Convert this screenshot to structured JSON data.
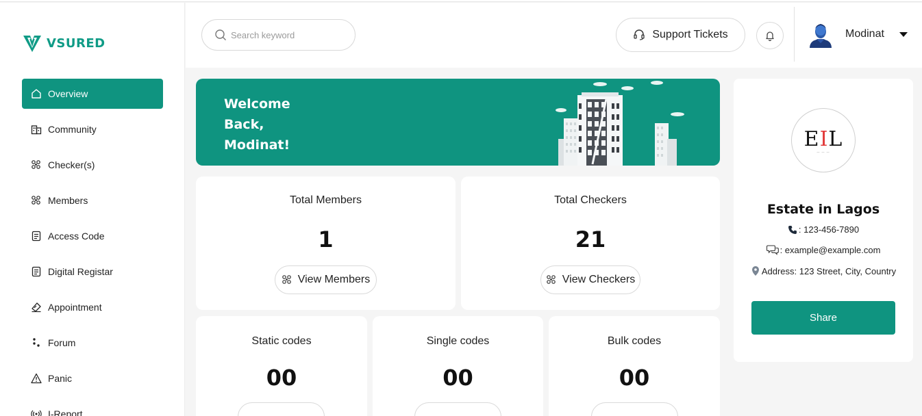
{
  "app": {
    "brand": "VSURED"
  },
  "sidebar": {
    "items": [
      {
        "label": "Overview",
        "icon": "home-icon",
        "active": true
      },
      {
        "label": "Community",
        "icon": "building-icon"
      },
      {
        "label": "Checker(s)",
        "icon": "people-group-icon"
      },
      {
        "label": "Members",
        "icon": "people-group-icon"
      },
      {
        "label": "Access Code",
        "icon": "document-icon"
      },
      {
        "label": "Digital Registar",
        "icon": "document-icon"
      },
      {
        "label": "Appointment",
        "icon": "ticket-icon"
      },
      {
        "label": "Forum",
        "icon": "dots-icon"
      },
      {
        "label": "Panic",
        "icon": "warning-icon"
      },
      {
        "label": "I-Report",
        "icon": "broadcast-icon"
      }
    ]
  },
  "topbar": {
    "search_placeholder": "Search keyword",
    "support_label": "Support Tickets",
    "user_name": "Modinat"
  },
  "banner": {
    "line1": "Welcome",
    "line2": "Back,",
    "line3": "Modinat!"
  },
  "stats": {
    "members": {
      "label": "Total Members",
      "value": "1",
      "button": "View Members"
    },
    "checkers": {
      "label": "Total Checkers",
      "value": "21",
      "button": "View Checkers"
    }
  },
  "codes": [
    {
      "label": "Static codes",
      "value": "00"
    },
    {
      "label": "Single codes",
      "value": "00"
    },
    {
      "label": "Bulk codes",
      "value": "00"
    }
  ],
  "profile": {
    "logo_text": "EIL",
    "name": "Estate in Lagos",
    "phone": ": 123-456-7890",
    "email": ": example@example.com",
    "address": "Address: 123 Street, City, Country",
    "share_label": "Share"
  },
  "colors": {
    "primary": "#0f9480",
    "brand": "#0f9b86",
    "page_bg": "#f5f5f5"
  }
}
